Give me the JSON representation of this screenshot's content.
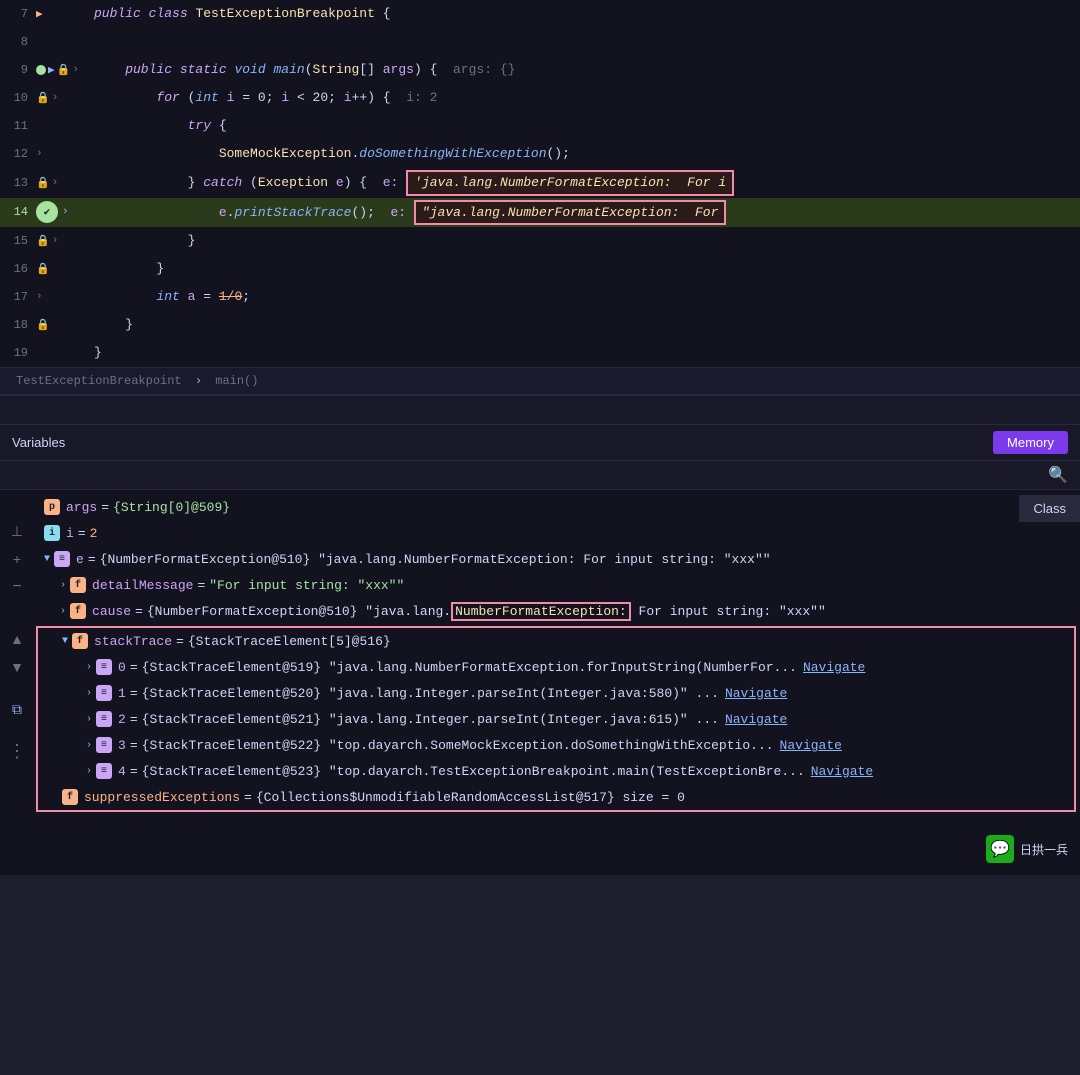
{
  "editor": {
    "lines": [
      {
        "num": "7",
        "hasArrow": false,
        "hasBreakpoint": false,
        "hasLock": false,
        "hasChevron": true,
        "chevronColor": "orange",
        "content": "public_class_TestExceptionBreakpoint"
      },
      {
        "num": "8",
        "content": ""
      },
      {
        "num": "9",
        "hasArrow": false,
        "hasBreakpoint": true,
        "hasLock": false,
        "hasChevron": true,
        "content": "public_static_void_main"
      },
      {
        "num": "10",
        "hasBreakpoint": false,
        "hasLock": true,
        "hasChevron": true,
        "content": "for_int_i_0"
      },
      {
        "num": "11",
        "hasBreakpoint": false,
        "hasLock": false,
        "hasChevron": false,
        "content": "try"
      },
      {
        "num": "12",
        "hasBreakpoint": false,
        "hasLock": false,
        "hasChevron": true,
        "content": "SomeMockException"
      },
      {
        "num": "13",
        "hasBreakpoint": false,
        "hasLock": true,
        "hasChevron": true,
        "content": "catch_Exception",
        "hasExceptionBox": true
      },
      {
        "num": "14",
        "isCurrentLine": true,
        "hasBreakpoint": false,
        "hasLock": false,
        "hasChevron": true,
        "content": "e_printStackTrace"
      },
      {
        "num": "15",
        "hasBreakpoint": false,
        "hasLock": true,
        "hasChevron": true,
        "content": "close_brace"
      },
      {
        "num": "16",
        "hasBreakpoint": false,
        "hasLock": true,
        "hasChevron": false,
        "content": "close_brace2"
      },
      {
        "num": "17",
        "hasBreakpoint": false,
        "hasLock": false,
        "hasChevron": true,
        "content": "int_a_divide"
      },
      {
        "num": "18",
        "hasBreakpoint": false,
        "hasLock": true,
        "hasChevron": false,
        "content": "close_brace3"
      },
      {
        "num": "19",
        "hasBreakpoint": false,
        "hasLock": false,
        "hasChevron": false,
        "content": "close_brace4"
      }
    ],
    "breadcrumb": {
      "class": "TestExceptionBreakpoint",
      "method": "main()",
      "separator": "›"
    }
  },
  "variables_panel": {
    "title": "Variables",
    "memory_btn": "Memory",
    "search_placeholder": "Search",
    "class_btn": "Class",
    "vars": [
      {
        "indent": 0,
        "badge": "p",
        "name": "args",
        "eq": "=",
        "value": "{String[0]@509}"
      },
      {
        "indent": 0,
        "badge": "i",
        "name": "i",
        "eq": "=",
        "value": "2"
      },
      {
        "indent": 0,
        "badge": "list",
        "expanded": true,
        "name": "e",
        "eq": "=",
        "value": "{NumberFormatException@510} \"java.lang.NumberFormatException: For input string: \\\"xxx\\\"\""
      },
      {
        "indent": 1,
        "badge": "f",
        "expanded": false,
        "name": "detailMessage",
        "eq": "=",
        "value": "\"For input string: \\\"xxx\\\"\""
      },
      {
        "indent": 1,
        "badge": "f",
        "expanded": false,
        "name": "cause",
        "eq": "=",
        "value": "{NumberFormatException@510} \"java.lang.",
        "redHighlight": "NumberFormatException:",
        "valueSuffix": " For input string: \\\"xxx\\\"\""
      },
      {
        "indent": 1,
        "badge": "f",
        "expanded": true,
        "name": "stackTrace",
        "eq": "=",
        "value": "{StackTraceElement[5]@516}",
        "inRedBox": true
      },
      {
        "indent": 2,
        "badge": "list",
        "expanded": false,
        "name": "0",
        "eq": "=",
        "value": "{StackTraceElement@519} \"java.lang.NumberFormatException.forInputString(NumberFor...",
        "navLink": "Navigate",
        "inRedBox": true
      },
      {
        "indent": 2,
        "badge": "list",
        "expanded": false,
        "name": "1",
        "eq": "=",
        "value": "{StackTraceElement@520} \"java.lang.Integer.parseInt(Integer.java:580)\" ...",
        "navLink": "Navigate",
        "inRedBox": true
      },
      {
        "indent": 2,
        "badge": "list",
        "expanded": false,
        "name": "2",
        "eq": "=",
        "value": "{StackTraceElement@521} \"java.lang.Integer.parseInt(Integer.java:615)\" ...",
        "navLink": "Navigate",
        "inRedBox": true
      },
      {
        "indent": 2,
        "badge": "list",
        "expanded": false,
        "name": "3",
        "eq": "=",
        "value": "{StackTraceElement@522} \"top.dayarch.SomeMockException.doSomethingWithExceptio...",
        "navLink": "Navigate",
        "inRedBox": true
      },
      {
        "indent": 2,
        "badge": "list",
        "expanded": false,
        "name": "4",
        "eq": "=",
        "value": "{StackTraceElement@523} \"top.dayarch.TestExceptionBreakpoint.main(TestExceptionBre...",
        "navLink": "Navigate",
        "inRedBox": true
      },
      {
        "indent": 1,
        "badge": "f",
        "name": "suppressedExceptions",
        "eq": "=",
        "value": "{Collections$UnmodifiableRandomAccessList@517}  size = 0",
        "inRedBox": true
      }
    ]
  },
  "watermark": {
    "wechat_text": "日拱一兵"
  }
}
